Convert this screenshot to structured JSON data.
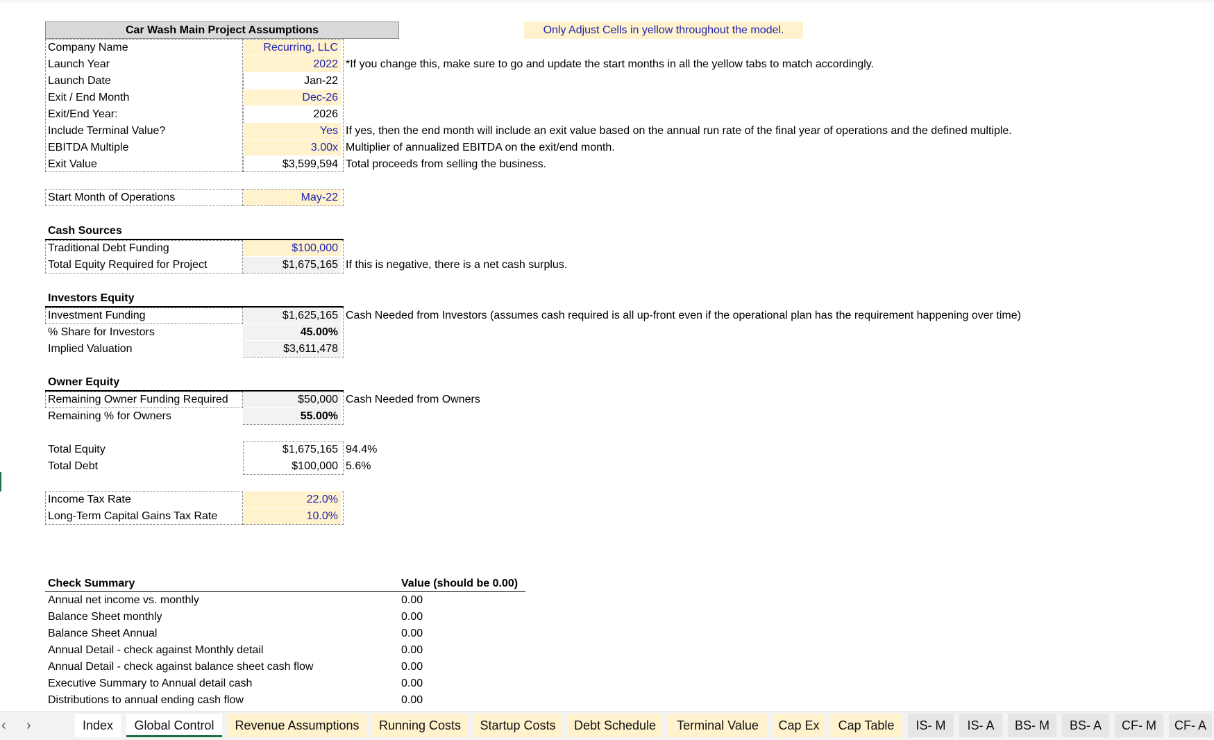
{
  "header": {
    "title": "Car Wash Main Project Assumptions",
    "banner": "Only Adjust Cells in yellow throughout the model."
  },
  "assumptions": [
    {
      "label": "Company Name",
      "value": "Recurring, LLC",
      "note": ""
    },
    {
      "label": "Launch Year",
      "value": "2022",
      "note": "*If you change this, make sure to go and update the start months in all the yellow tabs to match accordingly."
    },
    {
      "label": "Launch Date",
      "value": "Jan-22",
      "note": ""
    },
    {
      "label": "Exit / End Month",
      "value": "Dec-26",
      "note": ""
    },
    {
      "label": "Exit/End Year:",
      "value": "2026",
      "note": ""
    },
    {
      "label": "Include Terminal Value?",
      "value": "Yes",
      "note": "If yes, then the end month will include an exit value based on the annual run rate of the final year of operations and the defined multiple."
    },
    {
      "label": "EBITDA Multiple",
      "value": "3.00x",
      "note": "Multiplier of annualized EBITDA on the exit/end month."
    },
    {
      "label": "Exit Value",
      "value": "$3,599,594",
      "note": "Total proceeds from selling the business."
    }
  ],
  "start": {
    "label": "Start Month of Operations",
    "value": "May-22"
  },
  "cash_sources": {
    "title": "Cash Sources",
    "rows": [
      {
        "label": "Traditional Debt Funding",
        "value": "$100,000",
        "note": ""
      },
      {
        "label": "Total Equity Required for Project",
        "value": "$1,675,165",
        "note": "If this is negative, there is a net cash surplus."
      }
    ]
  },
  "investors": {
    "title": "Investors Equity",
    "rows": [
      {
        "label": "Investment Funding",
        "value": "$1,625,165",
        "note": "Cash Needed from Investors (assumes cash required is all up-front even if the operational plan has the requirement happening over time)"
      },
      {
        "label": "% Share for Investors",
        "value": "45.00%",
        "note": ""
      },
      {
        "label": "Implied Valuation",
        "value": "$3,611,478",
        "note": ""
      }
    ]
  },
  "owners": {
    "title": "Owner Equity",
    "rows": [
      {
        "label": "Remaining Owner Funding Required",
        "value": "$50,000",
        "note": "Cash Needed from Owners"
      },
      {
        "label": "Remaining % for Owners",
        "value": "55.00%",
        "note": ""
      }
    ]
  },
  "totals": [
    {
      "label": "Total Equity",
      "value": "$1,675,165",
      "note": "94.4%"
    },
    {
      "label": "Total Debt",
      "value": "$100,000",
      "note": "5.6%"
    }
  ],
  "taxes": [
    {
      "label": "Income Tax Rate",
      "value": "22.0%"
    },
    {
      "label": "Long-Term Capital Gains Tax Rate",
      "value": "10.0%"
    }
  ],
  "checks": {
    "title": "Check Summary",
    "value_header": "Value (should be 0.00)",
    "rows": [
      {
        "label": "Annual net income vs. monthly",
        "value": "0.00"
      },
      {
        "label": "Balance Sheet monthly",
        "value": "0.00"
      },
      {
        "label": "Balance Sheet Annual",
        "value": "0.00"
      },
      {
        "label": "Annual Detail - check against Monthly detail",
        "value": "0.00"
      },
      {
        "label": "Annual Detail - check against balance sheet cash flow",
        "value": "0.00"
      },
      {
        "label": "Executive Summary to Annual detail cash",
        "value": "0.00"
      },
      {
        "label": "Distributions to annual ending cash flow",
        "value": "0.00"
      }
    ]
  },
  "tabs": [
    "Index",
    "Global Control",
    "Revenue Assumptions",
    "Running Costs",
    "Startup Costs",
    "Debt Schedule",
    "Terminal Value",
    "Cap Ex",
    "Cap Table",
    "IS- M",
    "IS- A",
    "BS- M",
    "BS- A",
    "CF- M",
    "CF- A"
  ],
  "nav": {
    "prev": "‹",
    "next": "›"
  },
  "colors": {
    "yellow_cell": "#fff2cc",
    "input_text": "#1f25b0",
    "grey_cell": "#f2f2f2",
    "active_tab": "#1e7145"
  }
}
